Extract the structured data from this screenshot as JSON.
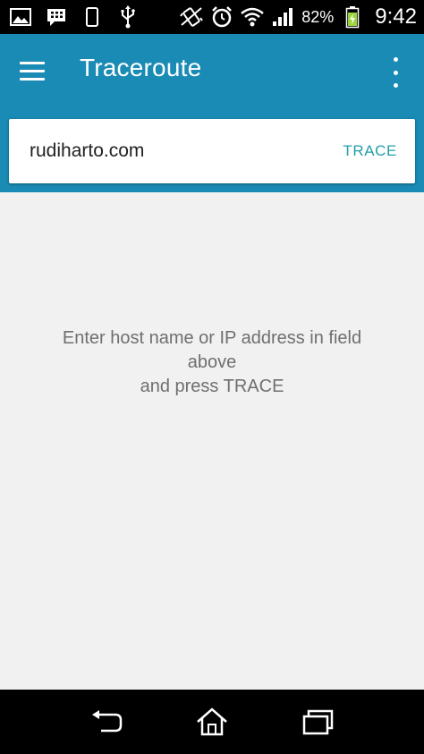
{
  "status_bar": {
    "left_icons": [
      "gallery-icon",
      "bbm-icon",
      "phone-icon",
      "usb-icon"
    ],
    "right_icons": [
      "vibrate-icon",
      "alarm-icon",
      "wifi-icon",
      "signal-icon",
      "battery-icon"
    ],
    "battery_percent": "82%",
    "time": "9:42"
  },
  "toolbar": {
    "title": "Traceroute",
    "menu_icon": "hamburger-menu-icon",
    "overflow_icon": "more-vertical-icon"
  },
  "search": {
    "value": "rudiharto.com",
    "placeholder": "",
    "button_label": "TRACE"
  },
  "content": {
    "hint_lines": [
      "Enter host name or IP address in field",
      "above",
      "and press TRACE"
    ]
  },
  "navigation": {
    "icons": [
      "back-icon",
      "home-icon",
      "recent-apps-icon"
    ]
  },
  "colors": {
    "app_bar": "#1a8bb4",
    "accent": "#24a0a8",
    "content_bg": "#f1f1f1",
    "hint_text": "#6f6f6f"
  }
}
